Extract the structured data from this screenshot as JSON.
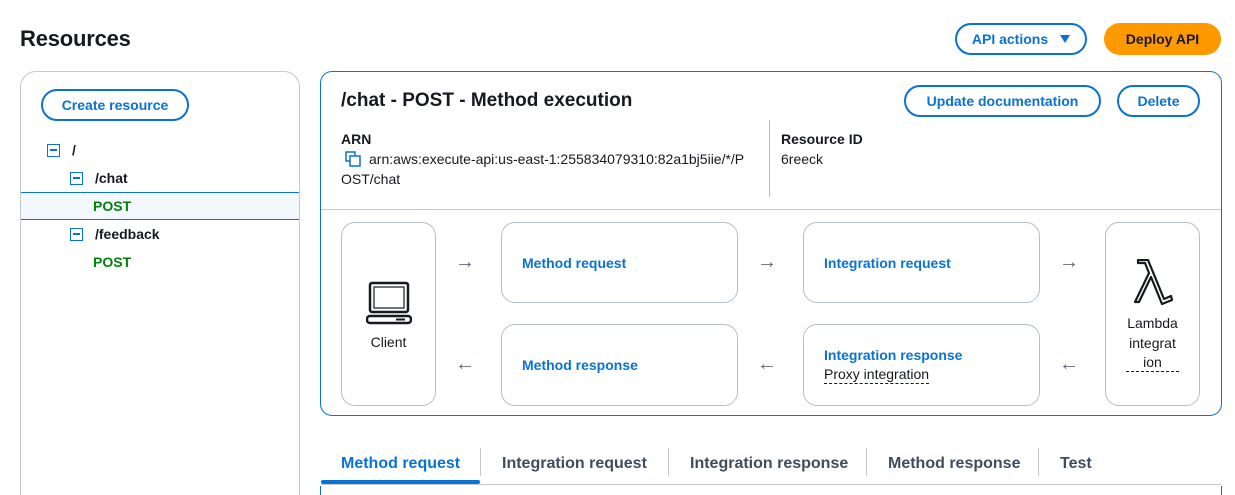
{
  "header": {
    "title": "Resources",
    "api_actions_label": "API actions",
    "deploy_label": "Deploy API"
  },
  "sidebar": {
    "create_resource_label": "Create resource",
    "tree": [
      {
        "path": "/",
        "type": "resource",
        "expanded": true
      },
      {
        "path": "/chat",
        "type": "resource",
        "expanded": true
      },
      {
        "method": "POST",
        "type": "method",
        "selected": true
      },
      {
        "path": "/feedback",
        "type": "resource",
        "expanded": true
      },
      {
        "method": "POST",
        "type": "method",
        "selected": false
      }
    ]
  },
  "method_execution": {
    "title": "/chat - POST - Method execution",
    "update_doc_label": "Update documentation",
    "delete_label": "Delete",
    "arn_label": "ARN",
    "arn_line1": "arn:aws:execute-api:us-east-1:255834079310:82a1bj5iie/*/P",
    "arn_line2": "OST/chat",
    "resource_id_label": "Resource ID",
    "resource_id_value": "6reeck"
  },
  "flow": {
    "client_label": "Client",
    "method_request": "Method request",
    "integration_request": "Integration request",
    "method_response": "Method response",
    "integration_response": "Integration response",
    "integration_response_sub": "Proxy integration",
    "lambda_line1": "Lambda",
    "lambda_line2": "integrat",
    "lambda_line3": "ion"
  },
  "tabs": [
    {
      "label": "Method request",
      "active": true
    },
    {
      "label": "Integration request",
      "active": false
    },
    {
      "label": "Integration response",
      "active": false
    },
    {
      "label": "Method response",
      "active": false
    },
    {
      "label": "Test",
      "active": false
    }
  ],
  "colors": {
    "accent": "#0972d3",
    "primary_button": "#ff9900",
    "method_green": "#037f0c"
  },
  "icons": [
    "copy-icon",
    "monitor-icon",
    "lambda-icon",
    "arrow-right-icon",
    "arrow-left-icon",
    "collapse-icon",
    "caret-down-icon"
  ]
}
